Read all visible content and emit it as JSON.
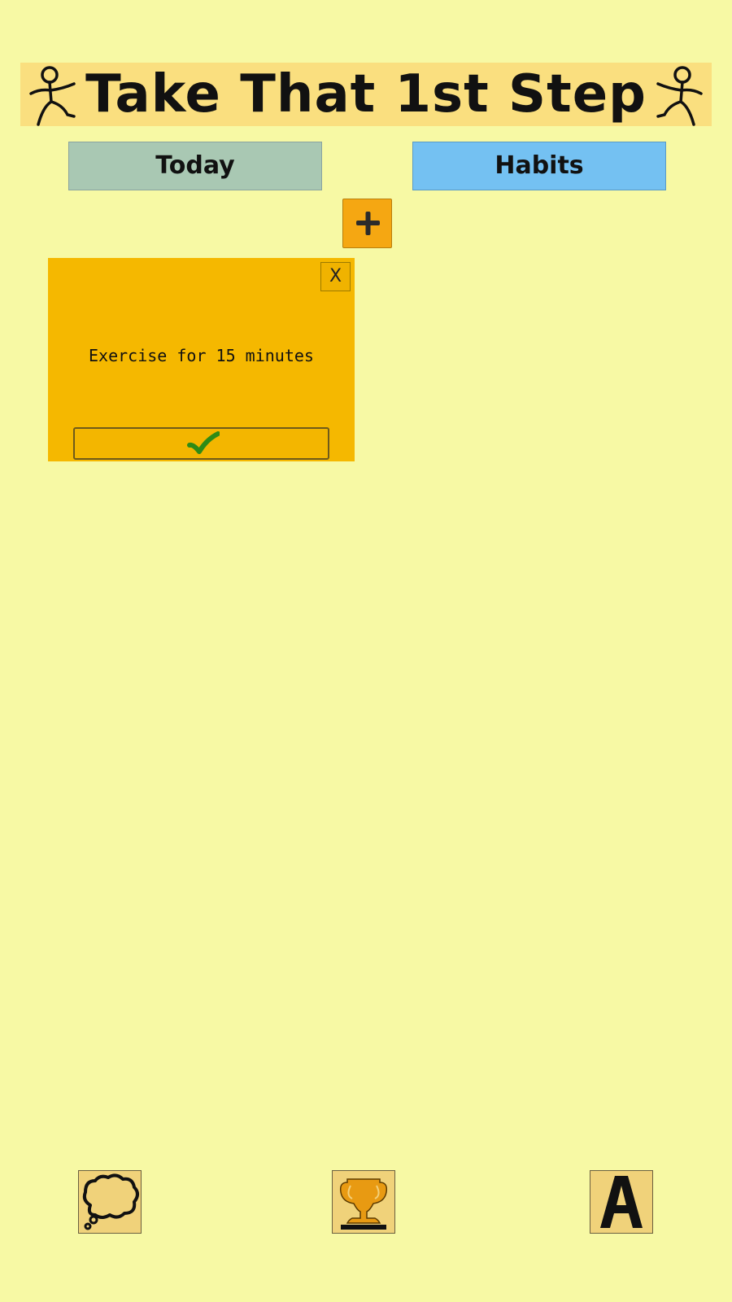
{
  "app": {
    "title": "Take That 1st Step"
  },
  "tabs": [
    {
      "label": "Today",
      "color": "#a9c8b3"
    },
    {
      "label": "Habits",
      "color": "#74c1f2"
    }
  ],
  "add_button": {
    "icon": "plus-icon"
  },
  "habits": [
    {
      "text": "Exercise for 15 minutes",
      "close_label": "X",
      "done_icon": "checkmark-icon"
    }
  ],
  "bottom_nav": [
    {
      "name": "thoughts",
      "icon": "thought-bubble-icon"
    },
    {
      "name": "trophy",
      "icon": "trophy-icon"
    },
    {
      "name": "font",
      "icon": "letter-a-icon"
    }
  ],
  "colors": {
    "background": "#f7f9a4",
    "banner": "#fadf7f",
    "card": "#f5b800",
    "accent": "#f5a712",
    "check": "#2e8b16"
  }
}
